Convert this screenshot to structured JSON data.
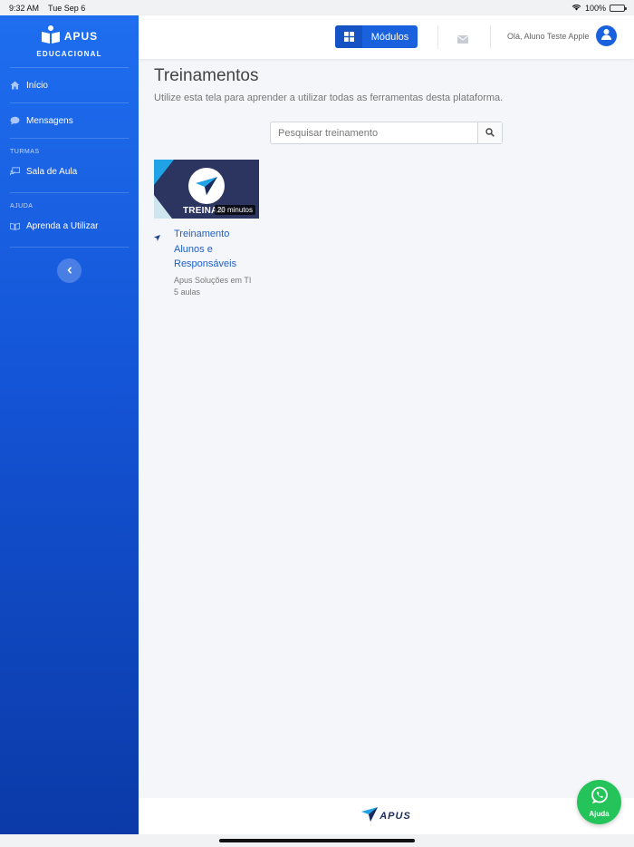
{
  "status_bar": {
    "time": "9:32 AM",
    "date": "Tue Sep 6",
    "battery": "100%"
  },
  "sidebar": {
    "logo_title": "APUS",
    "logo_subtitle": "EDUCACIONAL",
    "items": [
      {
        "label": "Início"
      },
      {
        "label": "Mensagens"
      }
    ],
    "group_turmas": "TURMAS",
    "turmas_items": [
      {
        "label": "Sala de Aula"
      }
    ],
    "group_ajuda": "AJUDA",
    "ajuda_items": [
      {
        "label": "Aprenda a Utilizar"
      }
    ]
  },
  "topbar": {
    "modules_label": "Módulos",
    "greeting": "Olá, Aluno Teste Apple"
  },
  "main": {
    "title": "Treinamentos",
    "subtitle": "Utilize esta tela para aprender a utilizar todas as ferramentas desta plataforma.",
    "search_placeholder": "Pesquisar treinamento"
  },
  "cards": [
    {
      "thumb_text": "TREINAM",
      "duration": "20 minutos",
      "title_lines": [
        "Treinamento",
        "Alunos e",
        "Responsáveis"
      ],
      "author": "Apus Soluções em TI",
      "lessons": "5 aulas"
    }
  ],
  "footer": {
    "logo_text": "APUS"
  },
  "help_button": {
    "label": "Ajuda"
  },
  "colors": {
    "primary": "#1a62dd",
    "sidebar_top": "#1f6ef0",
    "sidebar_bottom": "#0b3aa8",
    "whatsapp": "#25c45a"
  }
}
